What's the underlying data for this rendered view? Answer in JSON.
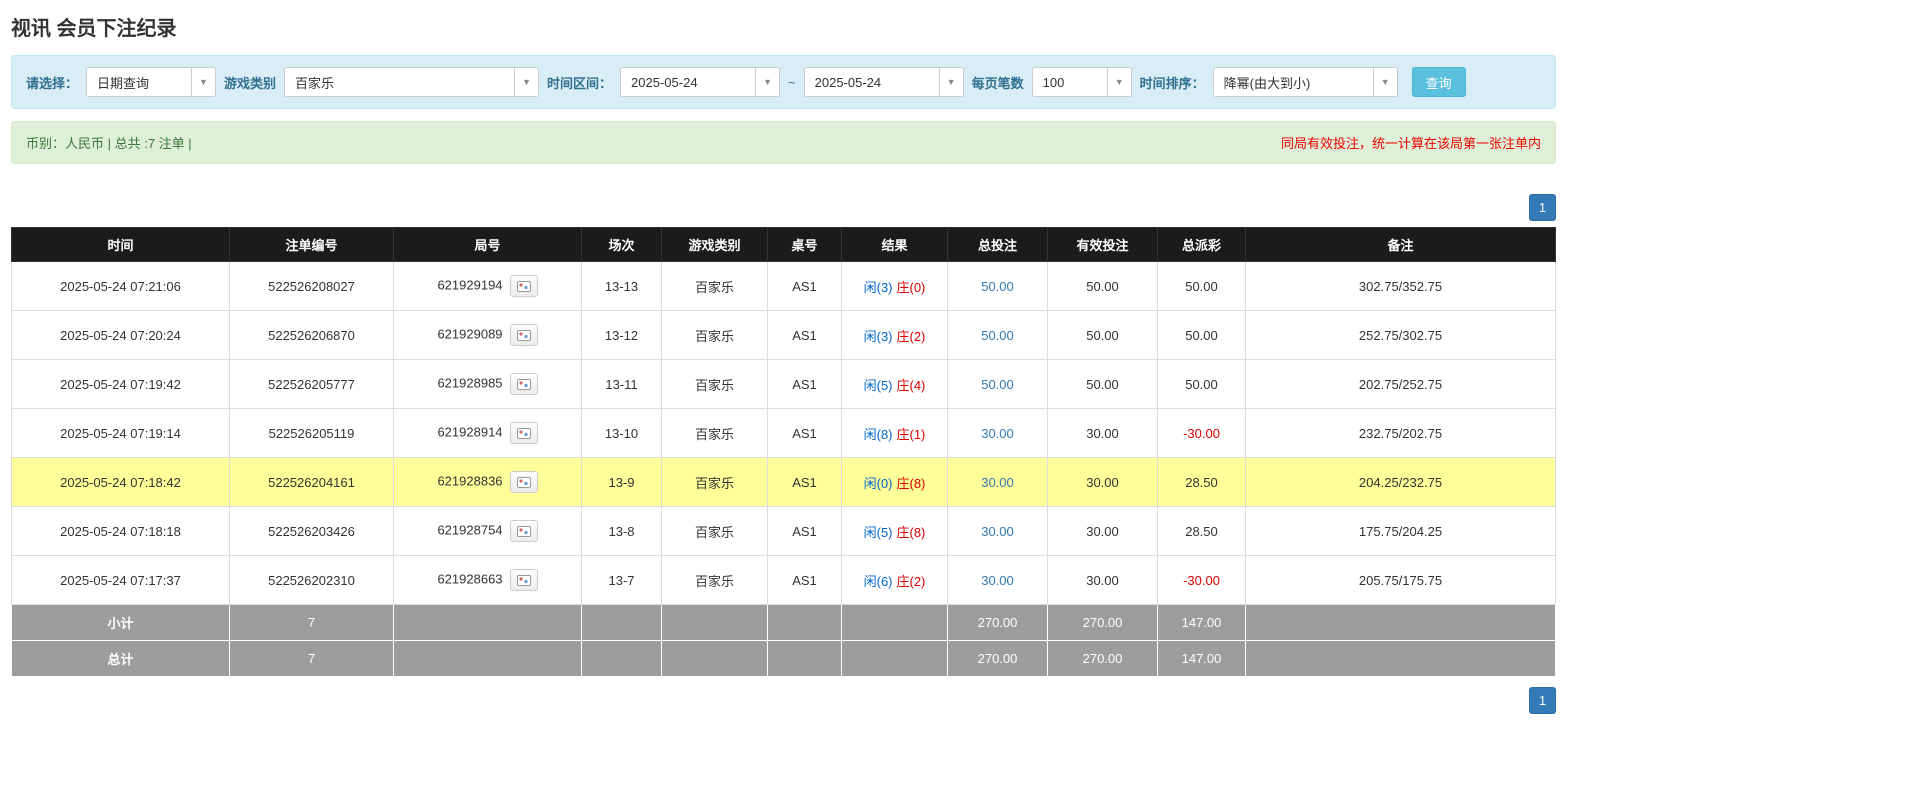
{
  "page": {
    "title": "视讯 会员下注纪录"
  },
  "colors": {
    "header_bg": "#1b1b1b",
    "highlight_row": "#ffff99",
    "link_blue": "#337ab7",
    "player_blue": "#0066cc",
    "banker_red": "#dd0000",
    "negative_red": "#dd0000",
    "footer_bg": "#9d9d9d",
    "filter_bg": "#d9edf7",
    "summary_bg": "#dff0d8",
    "summary_text": "#3c763d",
    "note_red": "#ee0000",
    "pager_blue": "#337ab7",
    "search_btn": "#5bc0de"
  },
  "filters": {
    "select_label": "请选择：",
    "select_value": "日期查询",
    "game_type_label": "游戏类别",
    "game_type_value": "百家乐",
    "time_range_label": "时间区间：",
    "date_from": "2025-05-24",
    "tilde": "~",
    "date_to": "2025-05-24",
    "page_size_label": "每页笔数",
    "page_size_value": "100",
    "sort_label": "时间排序：",
    "sort_value": "降幂(由大到小)",
    "search_button": "查询",
    "arrow": "▼"
  },
  "summary": {
    "left": "币别：人民币 | 总共 :7 注单 |",
    "right": "同局有效投注，统一计算在该局第一张注单内"
  },
  "pagination": {
    "page": "1"
  },
  "table": {
    "headers": [
      "时间",
      "注单编号",
      "局号",
      "场次",
      "游戏类别",
      "桌号",
      "结果",
      "总投注",
      "有效投注",
      "总派彩",
      "备注"
    ],
    "rows": [
      {
        "time": "2025-05-24 07:21:06",
        "bet_id": "522526208027",
        "round_id": "621929194",
        "session": "13-13",
        "game": "百家乐",
        "table_no": "AS1",
        "result_player": "闲(3)",
        "result_banker": "庄(0)",
        "total_bet": "50.00",
        "valid_bet": "50.00",
        "payout": "50.00",
        "note": "302.75/352.75"
      },
      {
        "time": "2025-05-24 07:20:24",
        "bet_id": "522526206870",
        "round_id": "621929089",
        "session": "13-12",
        "game": "百家乐",
        "table_no": "AS1",
        "result_player": "闲(3)",
        "result_banker": "庄(2)",
        "total_bet": "50.00",
        "valid_bet": "50.00",
        "payout": "50.00",
        "note": "252.75/302.75"
      },
      {
        "time": "2025-05-24 07:19:42",
        "bet_id": "522526205777",
        "round_id": "621928985",
        "session": "13-11",
        "game": "百家乐",
        "table_no": "AS1",
        "result_player": "闲(5)",
        "result_banker": "庄(4)",
        "total_bet": "50.00",
        "valid_bet": "50.00",
        "payout": "50.00",
        "note": "202.75/252.75"
      },
      {
        "time": "2025-05-24 07:19:14",
        "bet_id": "522526205119",
        "round_id": "621928914",
        "session": "13-10",
        "game": "百家乐",
        "table_no": "AS1",
        "result_player": "闲(8)",
        "result_banker": "庄(1)",
        "total_bet": "30.00",
        "valid_bet": "30.00",
        "payout": "-30.00",
        "note": "232.75/202.75"
      },
      {
        "time": "2025-05-24 07:18:42",
        "bet_id": "522526204161",
        "round_id": "621928836",
        "session": "13-9",
        "game": "百家乐",
        "table_no": "AS1",
        "result_player": "闲(0)",
        "result_banker": "庄(8)",
        "total_bet": "30.00",
        "valid_bet": "30.00",
        "payout": "28.50",
        "note": "204.25/232.75"
      },
      {
        "time": "2025-05-24 07:18:18",
        "bet_id": "522526203426",
        "round_id": "621928754",
        "session": "13-8",
        "game": "百家乐",
        "table_no": "AS1",
        "result_player": "闲(5)",
        "result_banker": "庄(8)",
        "total_bet": "30.00",
        "valid_bet": "30.00",
        "payout": "28.50",
        "note": "175.75/204.25"
      },
      {
        "time": "2025-05-24 07:17:37",
        "bet_id": "522526202310",
        "round_id": "621928663",
        "session": "13-7",
        "game": "百家乐",
        "table_no": "AS1",
        "result_player": "闲(6)",
        "result_banker": "庄(2)",
        "total_bet": "30.00",
        "valid_bet": "30.00",
        "payout": "-30.00",
        "note": "205.75/175.75"
      }
    ],
    "subtotal": {
      "label": "小计",
      "count": "7",
      "total_bet": "270.00",
      "valid_bet": "270.00",
      "payout": "147.00"
    },
    "total": {
      "label": "总计",
      "count": "7",
      "total_bet": "270.00",
      "valid_bet": "270.00",
      "payout": "147.00"
    }
  }
}
